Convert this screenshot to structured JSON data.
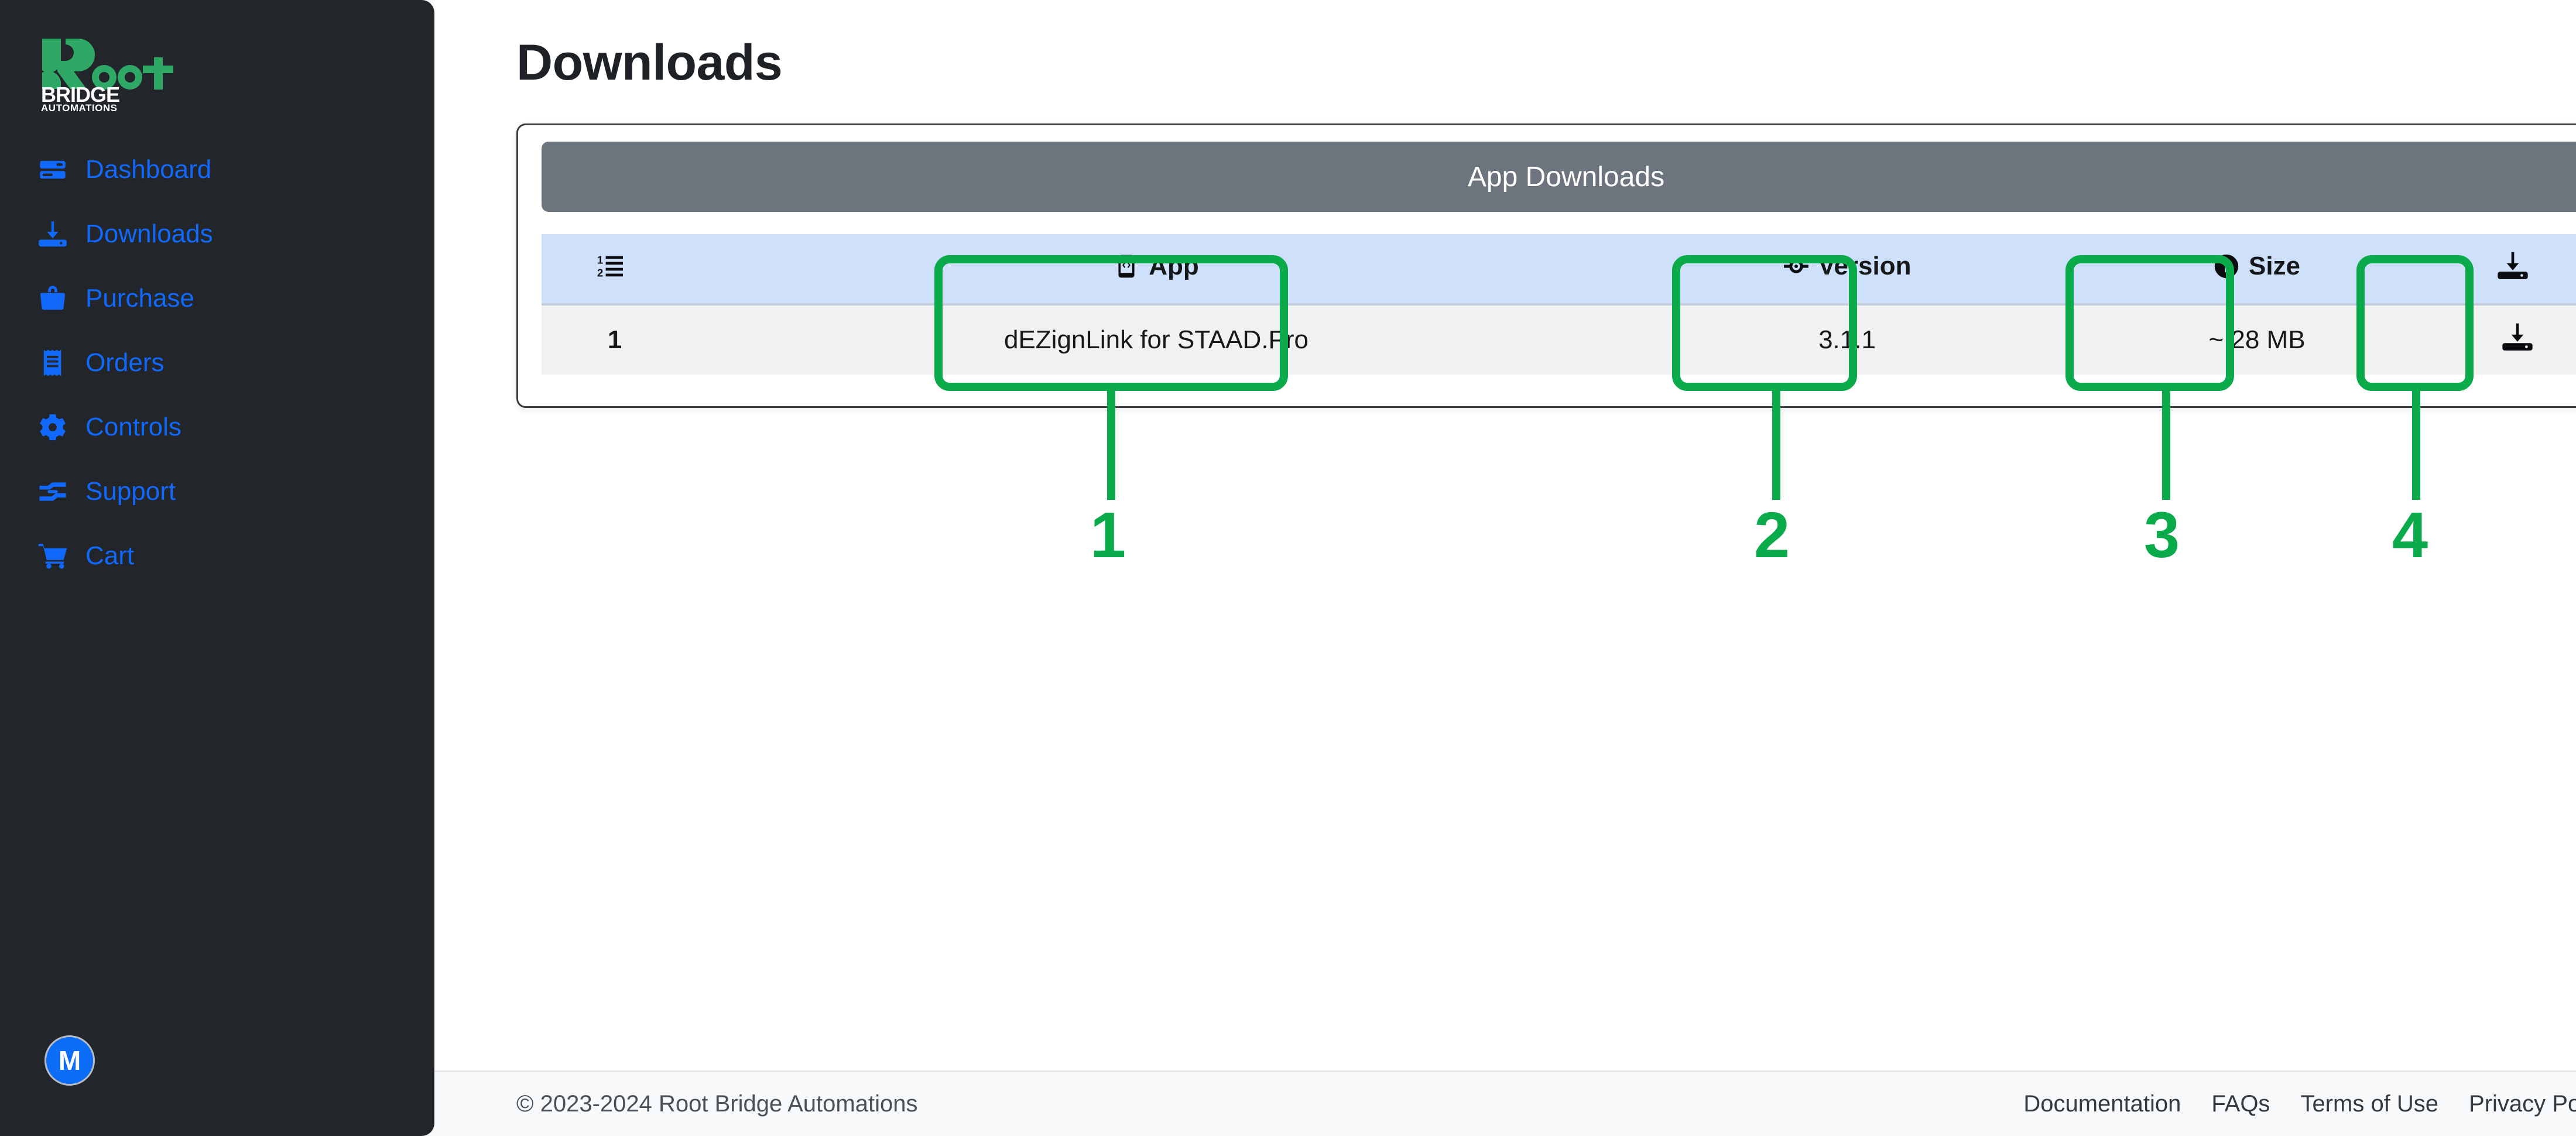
{
  "sidebar": {
    "logo": {
      "mark": "stylized-R",
      "word_top": "oot",
      "word_mid": "BRIDGE",
      "word_bottom": "AUTOMATIONS",
      "green": "#2ea864",
      "white": "#ffffff"
    },
    "items": [
      {
        "label": "Dashboard",
        "icon": "dashboard-icon"
      },
      {
        "label": "Downloads",
        "icon": "download-icon"
      },
      {
        "label": "Purchase",
        "icon": "shopping-bag-icon"
      },
      {
        "label": "Orders",
        "icon": "receipt-icon"
      },
      {
        "label": "Controls",
        "icon": "gear-icon"
      },
      {
        "label": "Support",
        "icon": "hands-helping-icon"
      },
      {
        "label": "Cart",
        "icon": "shopping-cart-icon"
      }
    ],
    "avatar": {
      "initial": "M",
      "color": "#0b6cf8"
    },
    "link_color": "#1169fb",
    "background": "#22262b"
  },
  "main": {
    "page_title": "Downloads",
    "card": {
      "header_title": "App Downloads",
      "header_color": "#6c757d",
      "table": {
        "header_row_color": "#cfe0fa",
        "body_row_color": "#f1f1f1",
        "columns": [
          {
            "key": "index",
            "label": "",
            "icon": "ordered-list-icon"
          },
          {
            "key": "app",
            "label": "App",
            "icon": "mobile-code-icon"
          },
          {
            "key": "version",
            "label": "Version",
            "icon": "code-branch-icon"
          },
          {
            "key": "size",
            "label": "Size",
            "icon": "info-circle-icon"
          },
          {
            "key": "action",
            "label": "",
            "icon": "download-icon"
          }
        ],
        "rows": [
          {
            "index": "1",
            "app": "dEZignLink for STAAD.Pro",
            "version": "3.1.1",
            "size": "~ 28 MB",
            "action_icon": "download-icon"
          }
        ]
      }
    }
  },
  "footer": {
    "copyright": "© 2023-2024 Root Bridge Automations",
    "links": [
      {
        "label": "Documentation"
      },
      {
        "label": "FAQs"
      },
      {
        "label": "Terms of Use"
      },
      {
        "label": "Privacy Policy"
      }
    ]
  },
  "annotations": {
    "color": "#0bab4b",
    "markers": [
      {
        "number": "1",
        "target": "app-column"
      },
      {
        "number": "2",
        "target": "version-column"
      },
      {
        "number": "3",
        "target": "size-column"
      },
      {
        "number": "4",
        "target": "download-column"
      }
    ]
  }
}
